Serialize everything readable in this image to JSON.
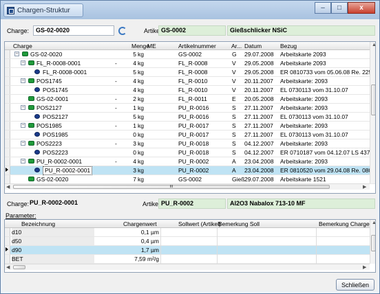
{
  "window": {
    "title": "Chargen-Struktur",
    "min": "–",
    "max": "□",
    "close": "x"
  },
  "top": {
    "charge_label": "Charge:",
    "charge_value": "GS-02-0020",
    "artikel_label": "Artikel:",
    "artikel_value": "GS-0002",
    "artikel_name": "Gießschlicker NSiC"
  },
  "tree_grid": {
    "headers": [
      "Charge",
      "Menge",
      "ME",
      "Artikelnummer",
      "Ar...",
      "Datum",
      "Bezug"
    ],
    "rows": [
      {
        "toggle": "−",
        "icon": "green",
        "charge": "GS-02-0020",
        "dot": "",
        "menge": "5",
        "me": "kg",
        "artikel": "GS-0002",
        "ar": "G",
        "datum": "29.07.2008",
        "bezug": "Arbeitskarte 2093"
      },
      {
        "toggle": "−",
        "icon": "green",
        "charge": "FL_R-0008-0001",
        "dot": "-",
        "menge": "4",
        "me": "kg",
        "artikel": "FL_R-0008",
        "ar": "V",
        "datum": "29.05.2008",
        "bezug": "Arbeitskarte 2093"
      },
      {
        "toggle": "",
        "icon": "navy",
        "charge": "FL_R-0008-0001",
        "dot": "",
        "menge": "5",
        "me": "kg",
        "artikel": "FL_R-0008",
        "ar": "V",
        "datum": "29.05.2008",
        "bezug": "ER 0810733  vom 05.06.08  Re. 22561-"
      },
      {
        "toggle": "−",
        "icon": "green",
        "charge": "POS1745",
        "dot": "-",
        "menge": "4",
        "me": "kg",
        "artikel": "FL_R-0010",
        "ar": "V",
        "datum": "20.11.2007",
        "bezug": "Arbeitskarte: 2093"
      },
      {
        "toggle": "",
        "icon": "navy",
        "charge": "POS1745",
        "dot": "",
        "menge": "4",
        "me": "kg",
        "artikel": "FL_R-0010",
        "ar": "V",
        "datum": "20.11.2007",
        "bezug": "EL 0730113  vom 31.10.07"
      },
      {
        "toggle": "",
        "icon": "green",
        "charge": "GS-02-0001",
        "dot": "-",
        "menge": "2",
        "me": "kg",
        "artikel": "FL_R-0011",
        "ar": "E",
        "datum": "20.05.2008",
        "bezug": "Arbeitskarte: 2093"
      },
      {
        "toggle": "−",
        "icon": "green",
        "charge": "POS2127",
        "dot": "-",
        "menge": "1",
        "me": "kg",
        "artikel": "PU_R-0016",
        "ar": "S",
        "datum": "27.11.2007",
        "bezug": "Arbeitskarte: 2093"
      },
      {
        "toggle": "",
        "icon": "navy",
        "charge": "POS2127",
        "dot": "",
        "menge": "5",
        "me": "kg",
        "artikel": "PU_R-0016",
        "ar": "S",
        "datum": "27.11.2007",
        "bezug": "EL 0730113  vom 31.10.07"
      },
      {
        "toggle": "−",
        "icon": "green",
        "charge": "POS1985",
        "dot": "-",
        "menge": "1",
        "me": "kg",
        "artikel": "PU_R-0017",
        "ar": "S",
        "datum": "27.11.2007",
        "bezug": "Arbeitskarte: 2093"
      },
      {
        "toggle": "",
        "icon": "navy",
        "charge": "POS1985",
        "dot": "",
        "menge": "0",
        "me": "kg",
        "artikel": "PU_R-0017",
        "ar": "S",
        "datum": "27.11.2007",
        "bezug": "EL 0730113  vom 31.10.07"
      },
      {
        "toggle": "−",
        "icon": "green",
        "charge": "POS2223",
        "dot": "-",
        "menge": "3",
        "me": "kg",
        "artikel": "PU_R-0018",
        "ar": "S",
        "datum": "04.12.2007",
        "bezug": "Arbeitskarte: 2093"
      },
      {
        "toggle": "",
        "icon": "navy",
        "charge": "POS2223",
        "dot": "",
        "menge": "0",
        "me": "kg",
        "artikel": "PU_R-0018",
        "ar": "S",
        "datum": "04.12.2007",
        "bezug": "ER 0710187  vom 04.12.07  LS 4374, R"
      },
      {
        "toggle": "−",
        "icon": "green",
        "charge": "PU_R-0002-0001",
        "dot": "-",
        "menge": "4",
        "me": "kg",
        "artikel": "PU_R-0002",
        "ar": "A",
        "datum": "23.04.2008",
        "bezug": "Arbeitskarte: 2093"
      },
      {
        "toggle": "",
        "icon": "navy",
        "charge": "PU_R-0002-0001",
        "dot": "",
        "menge": "3",
        "me": "kg",
        "artikel": "PU_R-0002",
        "ar": "A",
        "datum": "23.04.2008",
        "bezug": "ER 0810520  vom 29.04.08  Re. 0803",
        "selected": true
      },
      {
        "toggle": "",
        "icon": "green",
        "charge": "GS-02-0020",
        "dot": "",
        "menge": "7",
        "me": "kg",
        "artikel": "GS-0002",
        "ar": "Gieß",
        "datum": "29.07.2008",
        "bezug": "Arbeitskarte 1521"
      }
    ],
    "hscroll_marker": "III"
  },
  "bottom": {
    "charge_label": "Charge:",
    "charge_value": "PU_R-0002-0001",
    "artikel_label": "Artikel:",
    "artikel_value": "PU_R-0002",
    "artikel_name": "Al2O3 Nabalox 713-10 MF",
    "parameter_label": "Parameter:"
  },
  "param_grid": {
    "headers": [
      "Bezeichnung",
      "Chargenwert",
      "Sollwert (Artikel)",
      "Bemerkung Soll",
      "Bemerkung Charge"
    ],
    "rows": [
      {
        "name": "d10",
        "value": "0,1 µm"
      },
      {
        "name": "d50",
        "value": "0,4 µm"
      },
      {
        "name": "d90",
        "value": "1,7 µm",
        "selected": true
      },
      {
        "name": "BET",
        "value": "7,59 m²/g"
      }
    ]
  },
  "close_button": "Schließen",
  "colors": {
    "selected_row": "#bfe3f4",
    "green_field": "#ddefd9",
    "titlebar": "#a8c2e0"
  }
}
